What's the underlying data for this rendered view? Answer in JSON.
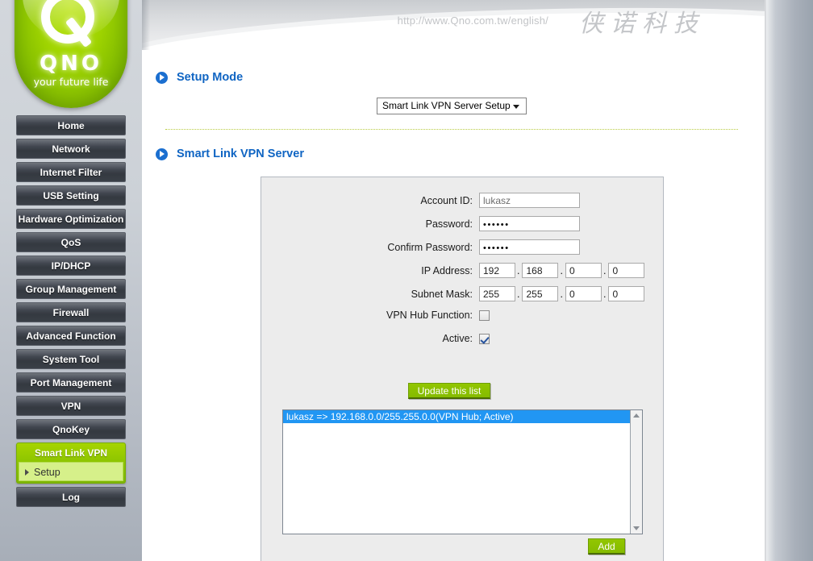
{
  "brand": {
    "logo_text": "QNO",
    "tagline": "your future life",
    "url": "http://www.Qno.com.tw/english/",
    "chinese_name": "侠诺科技"
  },
  "sidebar": {
    "items": [
      {
        "label": "Home"
      },
      {
        "label": "Network"
      },
      {
        "label": "Internet Filter"
      },
      {
        "label": "USB Setting"
      },
      {
        "label": "Hardware Optimization"
      },
      {
        "label": "QoS"
      },
      {
        "label": "IP/DHCP"
      },
      {
        "label": "Group Management"
      },
      {
        "label": "Firewall"
      },
      {
        "label": "Advanced Function"
      },
      {
        "label": "System Tool"
      },
      {
        "label": "Port Management"
      },
      {
        "label": "VPN"
      },
      {
        "label": "QnoKey"
      }
    ],
    "active_group": {
      "label": "Smart Link VPN",
      "sub_label": "Setup"
    },
    "last_item": {
      "label": "Log"
    },
    "accent_color": "#8cc400"
  },
  "main": {
    "setup_mode": {
      "title": "Setup Mode",
      "selected_option": "Smart Link VPN Server Setup"
    },
    "server_section": {
      "title": "Smart Link VPN Server"
    },
    "form": {
      "account_id_label": "Account ID:",
      "account_id_value": "lukasz",
      "password_label": "Password:",
      "password_value": "••••••",
      "confirm_password_label": "Confirm Password:",
      "confirm_password_value": "••••••",
      "ip_address_label": "IP Address:",
      "ip_address": [
        "192",
        "168",
        "0",
        "0"
      ],
      "subnet_mask_label": "Subnet Mask:",
      "subnet_mask": [
        "255",
        "255",
        "0",
        "0"
      ],
      "vpn_hub_label": "VPN Hub Function:",
      "vpn_hub_checked": false,
      "active_label": "Active:",
      "active_checked": true,
      "dot": "."
    },
    "update_button": "Update this list",
    "list": {
      "entries": [
        "lukasz => 192.168.0.0/255.255.0.0(VPN Hub; Active)"
      ]
    },
    "add_button": "Add"
  },
  "colors": {
    "section_title": "#1065c3",
    "bullet": "#1b6fd0",
    "green_button": "#8cc400",
    "list_selection": "#2196f3"
  }
}
